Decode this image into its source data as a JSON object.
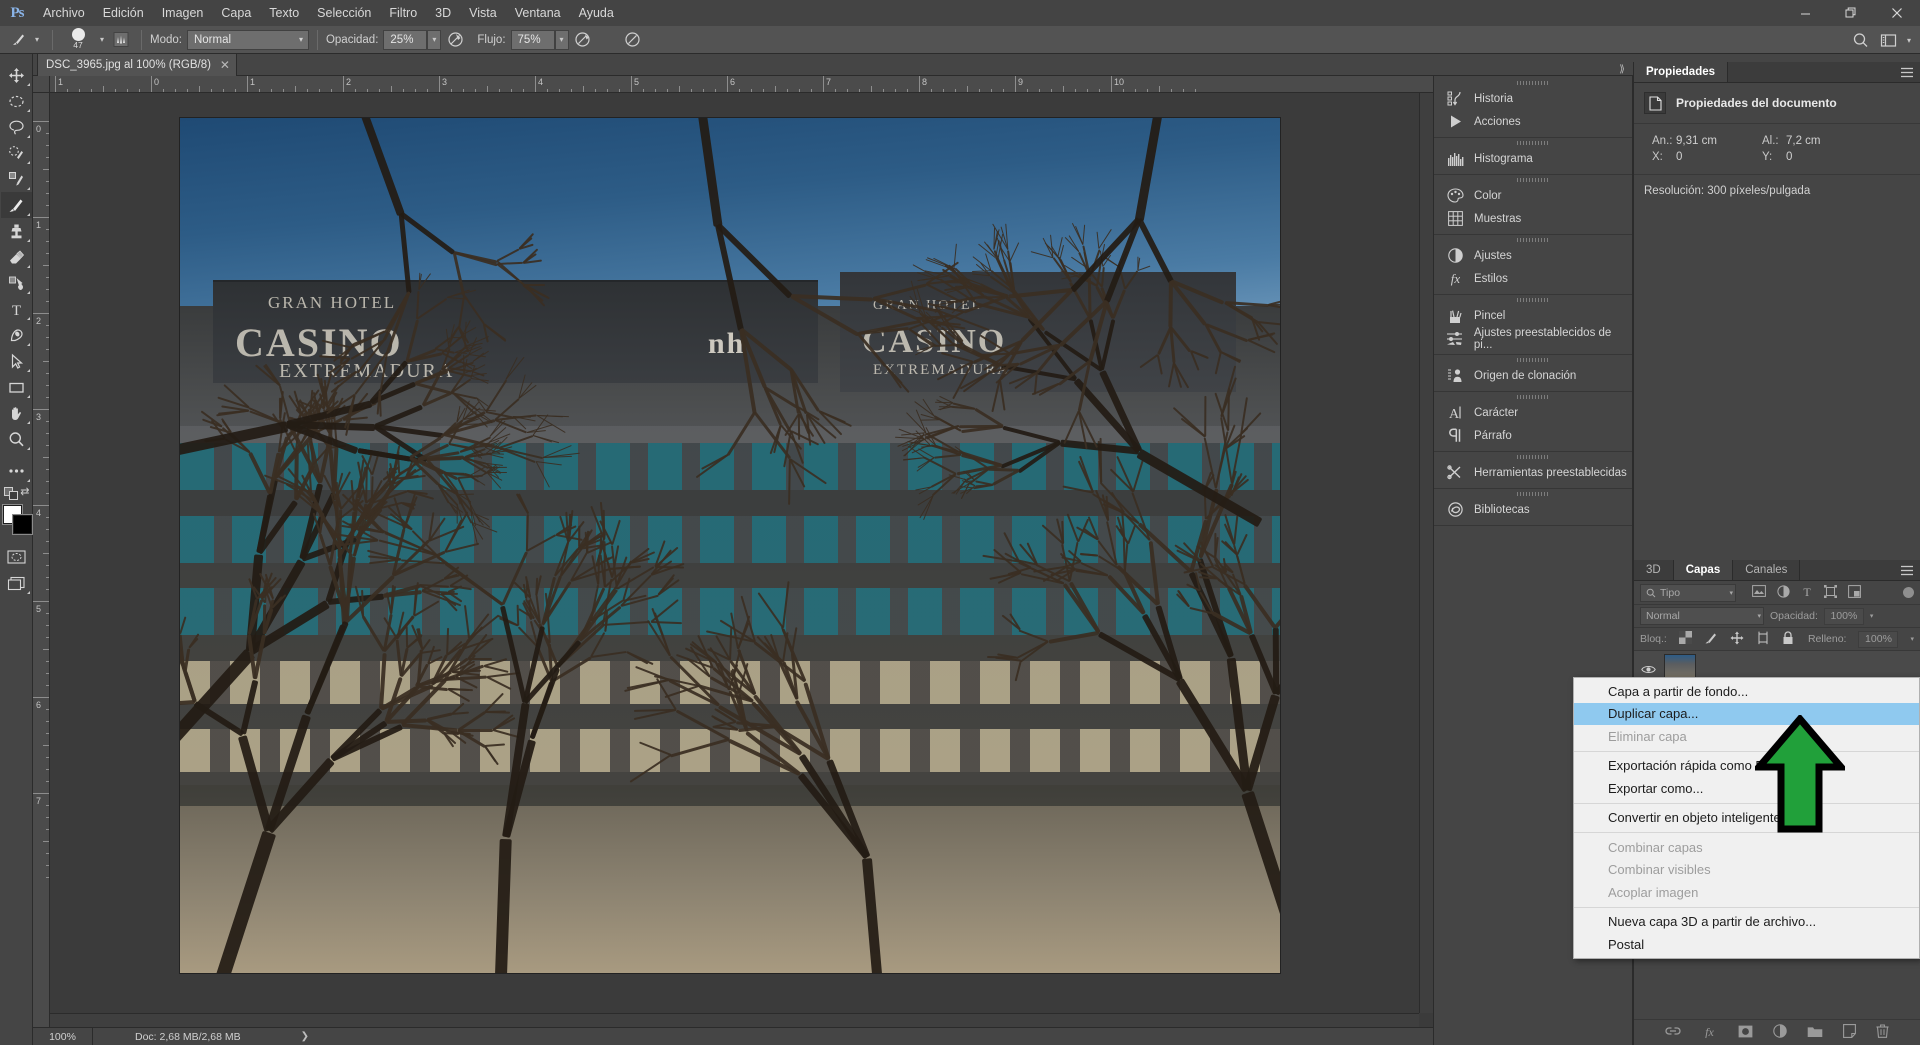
{
  "app": {
    "logo": "Ps",
    "menus": [
      "Archivo",
      "Edición",
      "Imagen",
      "Capa",
      "Texto",
      "Selección",
      "Filtro",
      "3D",
      "Vista",
      "Ventana",
      "Ayuda"
    ],
    "window_controls": {
      "minimize": "—",
      "restore": "❐",
      "close": "✕"
    }
  },
  "options_bar": {
    "brush_size": "47",
    "mode_label": "Modo:",
    "mode_value": "Normal",
    "opacity_label": "Opacidad:",
    "opacity_value": "25%",
    "flow_label": "Flujo:",
    "flow_value": "75%"
  },
  "document_tab": {
    "title": "DSC_3965.jpg al 100% (RGB/8)",
    "close": "✕"
  },
  "toolbar": {
    "tools": [
      {
        "name": "move-tool",
        "label": "Mover"
      },
      {
        "name": "marquee-tool",
        "label": "Marco rectangular"
      },
      {
        "name": "lasso-tool",
        "label": "Lazo"
      },
      {
        "name": "quick-selection-tool",
        "label": "Selección rápida"
      },
      {
        "name": "crop-tool",
        "label": "Recortar"
      },
      {
        "name": "eyedropper-tool",
        "label": "Cuentagotas"
      },
      {
        "name": "brush-tool",
        "label": "Pincel"
      },
      {
        "name": "clone-stamp-tool",
        "label": "Tampón de clonar"
      },
      {
        "name": "eraser-tool",
        "label": "Borrador"
      },
      {
        "name": "gradient-tool",
        "label": "Degradado"
      },
      {
        "name": "type-tool",
        "label": "Texto"
      },
      {
        "name": "pen-tool",
        "label": "Pluma"
      },
      {
        "name": "path-selection-tool",
        "label": "Selección de trazado"
      },
      {
        "name": "shape-tool",
        "label": "Rectángulo"
      },
      {
        "name": "hand-tool",
        "label": "Mano"
      },
      {
        "name": "zoom-tool",
        "label": "Zoom"
      },
      {
        "name": "more-tools",
        "label": "Editar barra de herramientas"
      }
    ],
    "foreground_color": "#ffffff",
    "background_color": "#000000"
  },
  "rulers": {
    "h_labels": [
      "1",
      "0",
      "1",
      "2",
      "3",
      "4",
      "5",
      "6",
      "7",
      "8",
      "9",
      "10"
    ],
    "v_labels": [
      "0",
      "1",
      "2",
      "3",
      "4",
      "5",
      "6",
      "7"
    ]
  },
  "canvas": {
    "photo_description": "Fotografía de un edificio de oficinas tras ramas de árbol sin hojas",
    "sign_primary": "CASINO",
    "sign_secondary": "GRAN HOTEL",
    "sign_tertiary": "EXTREMADURA",
    "sign_brand": "nh",
    "sign_right_1": "GRAN HOTEL",
    "sign_right_2": "CASINO",
    "sign_right_3": "EXTREMADURA"
  },
  "status_bar": {
    "zoom": "100%",
    "doc_info": "Doc: 2,68 MB/2,68 MB",
    "expand_arrow": "❯"
  },
  "dock": {
    "groups": [
      {
        "items": [
          {
            "icon": "history-icon",
            "label": "Historia"
          },
          {
            "icon": "actions-play-icon",
            "label": "Acciones"
          }
        ]
      },
      {
        "items": [
          {
            "icon": "histogram-icon",
            "label": "Histograma"
          }
        ]
      },
      {
        "items": [
          {
            "icon": "color-palette-icon",
            "label": "Color"
          },
          {
            "icon": "swatches-grid-icon",
            "label": "Muestras"
          }
        ]
      },
      {
        "items": [
          {
            "icon": "adjustments-circle-icon",
            "label": "Ajustes"
          },
          {
            "icon": "styles-fx-icon",
            "label": "Estilos"
          }
        ]
      },
      {
        "items": [
          {
            "icon": "brush-icon",
            "label": "Pincel"
          },
          {
            "icon": "brush-presets-icon",
            "label": "Ajustes preestablecidos de pi..."
          }
        ]
      },
      {
        "items": [
          {
            "icon": "clone-source-icon",
            "label": "Origen de clonación"
          }
        ]
      },
      {
        "items": [
          {
            "icon": "character-icon",
            "label": "Carácter"
          },
          {
            "icon": "paragraph-icon",
            "label": "Párrafo"
          }
        ]
      },
      {
        "items": [
          {
            "icon": "tool-presets-icon",
            "label": "Herramientas preestablecidas"
          }
        ]
      },
      {
        "items": [
          {
            "icon": "libraries-cc-icon",
            "label": "Bibliotecas"
          }
        ]
      }
    ]
  },
  "properties_panel": {
    "tab_label": "Propiedades",
    "header": "Propiedades del documento",
    "fields": [
      {
        "key": "An.:",
        "value": "9,31 cm"
      },
      {
        "key": "Al.:",
        "value": "7,2 cm"
      },
      {
        "key": "X:",
        "value": "0"
      },
      {
        "key": "Y:",
        "value": "0"
      }
    ],
    "resolution": "Resolución: 300 píxeles/pulgada"
  },
  "layers_panel": {
    "tabs": [
      {
        "label": "3D",
        "active": false
      },
      {
        "label": "Capas",
        "active": true
      },
      {
        "label": "Canales",
        "active": false
      }
    ],
    "filter_placeholder": "Tipo",
    "filter_icons": [
      "pixel-filter-icon",
      "adjustment-filter-icon",
      "type-filter-icon",
      "shape-filter-icon",
      "smart-object-filter-icon"
    ],
    "blend_mode": "Normal",
    "opacity_label": "Opacidad:",
    "opacity_value": "100%",
    "lock_label": "Bloq.:",
    "lock_icons": [
      "lock-transparency-icon",
      "lock-image-icon",
      "lock-position-icon",
      "lock-artboard-icon",
      "lock-all-icon"
    ],
    "fill_label": "Relleno:",
    "fill_value": "100%",
    "bottom_icons": [
      "link-layers-icon",
      "layer-style-fx-icon",
      "add-mask-icon",
      "new-adjustment-icon",
      "new-group-icon",
      "new-layer-icon",
      "delete-layer-icon"
    ]
  },
  "context_menu": {
    "items": [
      {
        "label": "Capa a partir de fondo...",
        "state": "normal"
      },
      {
        "label": "Duplicar capa...",
        "state": "highlight"
      },
      {
        "label": "Eliminar capa",
        "state": "disabled"
      },
      {
        "separator": true
      },
      {
        "label": "Exportación rápida como PNG",
        "state": "normal"
      },
      {
        "label": "Exportar como...",
        "state": "normal"
      },
      {
        "separator": true
      },
      {
        "label": "Convertir en objeto inteligente",
        "state": "normal"
      },
      {
        "separator": true
      },
      {
        "label": "Combinar capas",
        "state": "disabled"
      },
      {
        "label": "Combinar visibles",
        "state": "disabled"
      },
      {
        "label": "Acoplar imagen",
        "state": "disabled"
      },
      {
        "separator": true
      },
      {
        "label": "Nueva capa 3D a partir de archivo...",
        "state": "normal"
      },
      {
        "label": "Postal",
        "state": "normal"
      }
    ]
  },
  "colors": {
    "menubar_bg": "#444444",
    "panel_bg": "#454545",
    "canvas_bg": "#3b3b3b",
    "highlight_blue": "#8fc9ef",
    "arrow_green": "#21a03a",
    "accent_logo": "#8ab4e8"
  }
}
